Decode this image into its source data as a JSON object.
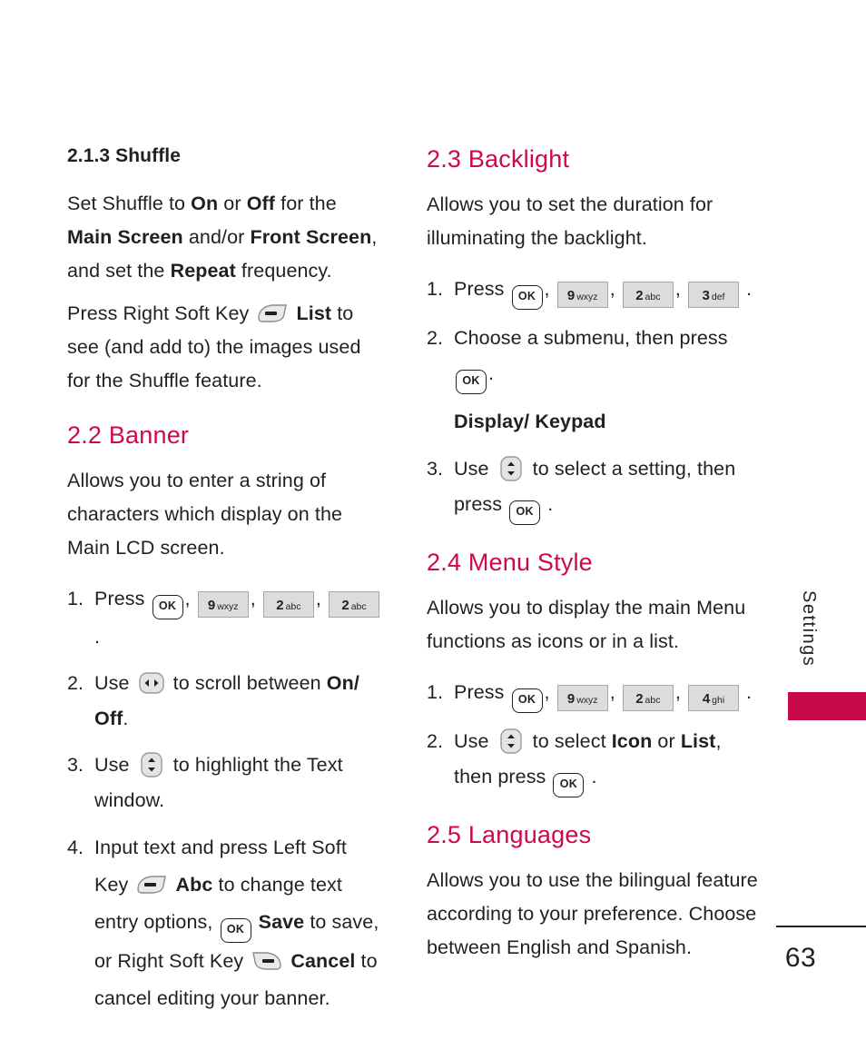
{
  "document": {
    "page_number": "63",
    "tab_label": "Settings",
    "accent_color": "#cc0a4a",
    "tab_block_color": "#c80a4b"
  },
  "left_column": {
    "section_213": {
      "heading": "2.1.3 Shuffle",
      "body": {
        "p1_a": "Set Shuffle to ",
        "p1_on": "On",
        "p1_b": " or ",
        "p1_off": "Off",
        "p1_c": " for the ",
        "p1_main_screen": "Main Screen",
        "p1_d": " and/or ",
        "p1_front_screen": "Front Screen",
        "p1_e": ", and set the ",
        "p1_repeat": "Repeat",
        "p1_f": " frequency.",
        "p2_a": "Press Right Soft Key ",
        "p2_list": "List",
        "p2_b": " to see (and add to) the images used for the Shuffle feature."
      }
    },
    "section_22": {
      "heading": "2.2 Banner",
      "intro": "Allows you to enter a string of characters which display on the Main LCD screen.",
      "steps": [
        {
          "num": "1.",
          "a": "Press ",
          "keys": [
            "OK",
            "9 wxyz",
            "2 abc",
            "2 abc"
          ],
          "b": "."
        },
        {
          "num": "2.",
          "a": "Use ",
          "b": " to scroll between ",
          "bold": "On/ Off",
          "c": "."
        },
        {
          "num": "3.",
          "a": "Use ",
          "b": " to highlight the Text window."
        },
        {
          "num": "4.",
          "a": "Input text and press Left Soft Key ",
          "abc": "Abc",
          "b": " to change text entry options, ",
          "save": "Save",
          "c": " to save, or Right Soft Key ",
          "cancel": "Cancel",
          "d": " to cancel editing your banner."
        }
      ]
    }
  },
  "right_column": {
    "section_23": {
      "heading": "2.3 Backlight",
      "intro": "Allows you to set the duration for illuminating the backlight.",
      "steps": [
        {
          "num": "1.",
          "a": "Press ",
          "keys": [
            "OK",
            "9 wxyz",
            "2 abc",
            "3 def"
          ],
          "b": "."
        },
        {
          "num": "2.",
          "a": "Choose a submenu, then press ",
          "b": "."
        },
        {
          "num": "3.",
          "a": "Use ",
          "b": " to select a setting, then press ",
          "c": "."
        }
      ],
      "submenu_label": "Display/ Keypad"
    },
    "section_24": {
      "heading": "2.4 Menu Style",
      "intro": "Allows you to display the main Menu functions as icons or in a list.",
      "steps": [
        {
          "num": "1.",
          "a": "Press ",
          "keys": [
            "OK",
            "9 wxyz",
            "2 abc",
            "4 ghi"
          ],
          "b": "."
        },
        {
          "num": "2.",
          "a": "Use ",
          "b": " to select ",
          "icon": "Icon",
          "c": " or ",
          "list": "List",
          "d": ", then press ",
          "e": "."
        }
      ]
    },
    "section_25": {
      "heading": "2.5 Languages",
      "intro": "Allows you to use the bilingual feature according to your preference. Choose between English and Spanish."
    }
  },
  "keys": {
    "ok": {
      "label": "OK"
    },
    "k9": {
      "digit": "9",
      "letters": "wxyz"
    },
    "k2": {
      "digit": "2",
      "letters": "abc"
    },
    "k3": {
      "digit": "3",
      "letters": "def"
    },
    "k4": {
      "digit": "4",
      "letters": "ghi"
    }
  }
}
